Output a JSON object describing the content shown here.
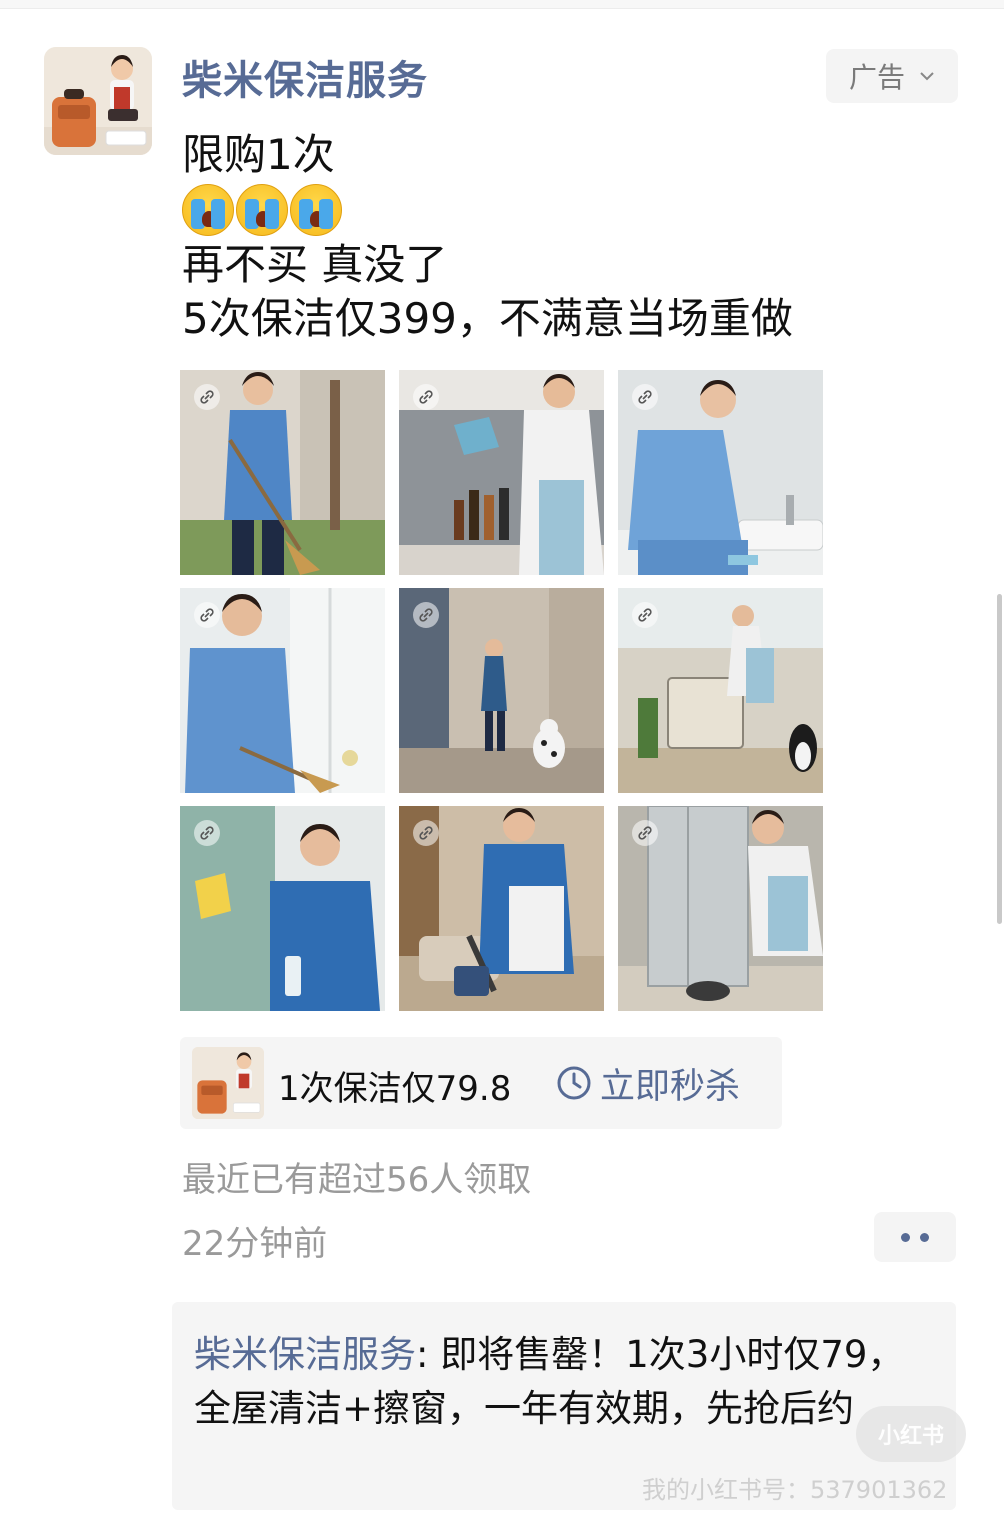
{
  "advertiser": {
    "name": "柴米保洁服务",
    "ad_label": "广告"
  },
  "post": {
    "line1": "限购1次",
    "emoji_count": 3,
    "emoji_name": "crying-face",
    "line3": "再不买 真没了",
    "line4": "5次保洁仅399，不满意当场重做"
  },
  "gallery": {
    "images": [
      {
        "subject": "cleaner sweeping yard with broom"
      },
      {
        "subject": "cleaner wiping kitchen backsplash"
      },
      {
        "subject": "cleaner scrubbing bathroom sink"
      },
      {
        "subject": "cleaner sweeping by window"
      },
      {
        "subject": "cleaner mopping hallway with dalmatian"
      },
      {
        "subject": "cleaner on balcony with dog crate"
      },
      {
        "subject": "cleaner wiping window glass"
      },
      {
        "subject": "cleaner vacuuming living room"
      },
      {
        "subject": "cleaner wiping refrigerator"
      }
    ]
  },
  "promo": {
    "text": "1次保洁仅79.8",
    "action_label": "立即秒杀"
  },
  "stats": {
    "claimed": "最近已有超过56人领取",
    "time_ago": "22分钟前"
  },
  "comment": {
    "author": "柴米保洁服务",
    "separator": ": ",
    "body": "即将售罄！1次3小时仅79，全屋清洁+擦窗，一年有效期，先抢后约"
  },
  "watermark": {
    "text": "我的小红书号：537901362",
    "logo": "小红书"
  },
  "colors": {
    "link_blue": "#576b95",
    "gray_text": "#9a9a9a",
    "panel_bg": "#f5f5f5"
  }
}
